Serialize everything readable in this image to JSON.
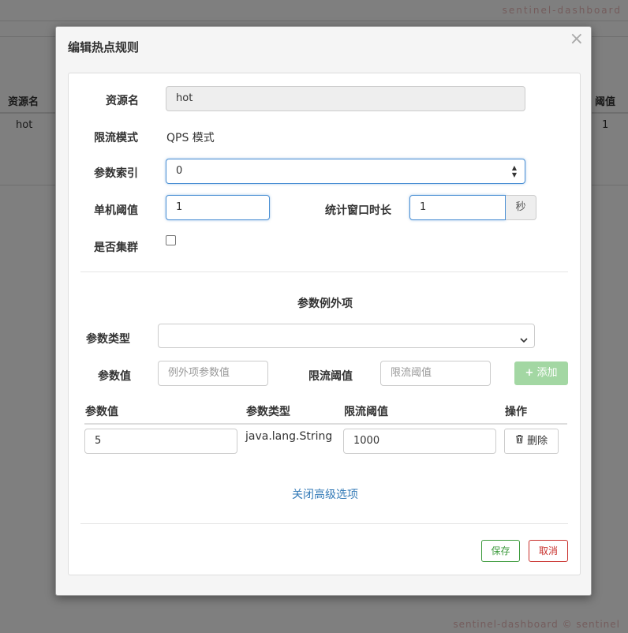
{
  "background": {
    "watermark_top": "sentinel-dashboard",
    "watermark_bottom": "sentinel-dashboard © sentinel",
    "table_header_left": "资源名",
    "table_header_right": "阈值",
    "row_resource": "hot",
    "row_threshold": "1"
  },
  "modal": {
    "title": "编辑热点规则",
    "close_glyph": "×"
  },
  "form": {
    "resource_label": "资源名",
    "resource_value": "hot",
    "mode_label": "限流模式",
    "mode_value": "QPS 模式",
    "param_index_label": "参数索引",
    "param_index_value": "0",
    "threshold_label": "单机阈值",
    "threshold_value": "1",
    "window_label": "统计窗口时长",
    "window_value": "1",
    "window_unit": "秒",
    "cluster_label": "是否集群",
    "cluster_checked": false
  },
  "exceptions": {
    "section_title": "参数例外项",
    "param_type_label": "参数类型",
    "param_type_selected": "",
    "param_value_label": "参数值",
    "param_value_placeholder": "例外项参数值",
    "limit_label": "限流阈值",
    "limit_placeholder": "限流阈值",
    "add_button": "添加",
    "table": {
      "headers": [
        "参数值",
        "参数类型",
        "限流阈值",
        "操作"
      ],
      "rows": [
        {
          "value": "5",
          "type": "java.lang.String",
          "limit": "1000",
          "action": "删除"
        }
      ]
    },
    "toggle_link": "关闭高级选项"
  },
  "footer": {
    "save_button": "保存",
    "cancel_button": "取消"
  },
  "colors": {
    "primary_link": "#337ab7",
    "success": "#3c9a3c",
    "danger": "#c9302c",
    "add_button_bg": "#a3d7a3",
    "focus_border": "#4a8fd4"
  },
  "icons": {
    "close": "close-icon",
    "plus": "plus-icon",
    "trash": "trash-icon",
    "spinner": "spinner-arrows-icon",
    "select": "chevron-down-icon"
  }
}
